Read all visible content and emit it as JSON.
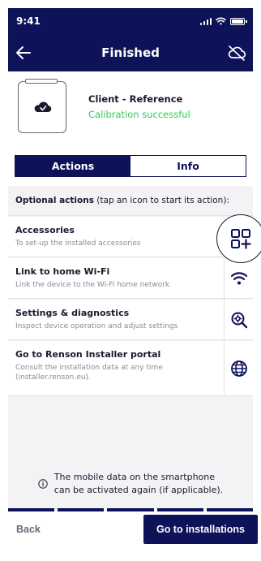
{
  "status_bar": {
    "time": "9:41"
  },
  "nav": {
    "title": "Finished",
    "back_icon": "arrow-left-icon",
    "cloud_icon": "cloud-off-icon"
  },
  "client": {
    "name": "Client - Reference",
    "status": "Calibration successful",
    "status_color": "#2ecc55"
  },
  "tabs": [
    {
      "label": "Actions",
      "active": true
    },
    {
      "label": "Info",
      "active": false
    }
  ],
  "actions_header": {
    "bold": "Optional actions",
    "rest": " (tap an icon to start its action):"
  },
  "actions": [
    {
      "title": "Accessories",
      "desc": "To set-up the installed accessories",
      "icon": "grid-plus-icon"
    },
    {
      "title": "Link to home Wi-Fi",
      "desc": "Link the device to the Wi-Fi home network",
      "icon": "wifi-icon"
    },
    {
      "title": "Settings & diagnostics",
      "desc": "Inspect device operation and adjust settings",
      "icon": "search-gear-icon"
    },
    {
      "title": "Go to Renson Installer portal",
      "desc": "Consult the installation data at any time (installer.renson.eu).",
      "icon": "globe-icon"
    }
  ],
  "info_note": {
    "line1": "The mobile data on the smartphone",
    "line2": "can be activated again (if applicable).",
    "icon": "info-icon"
  },
  "footer": {
    "back_label": "Back",
    "go_label": "Go to installations"
  },
  "colors": {
    "primary": "#0d1259",
    "success": "#2ecc55",
    "panel_bg": "#f3f3f6"
  }
}
